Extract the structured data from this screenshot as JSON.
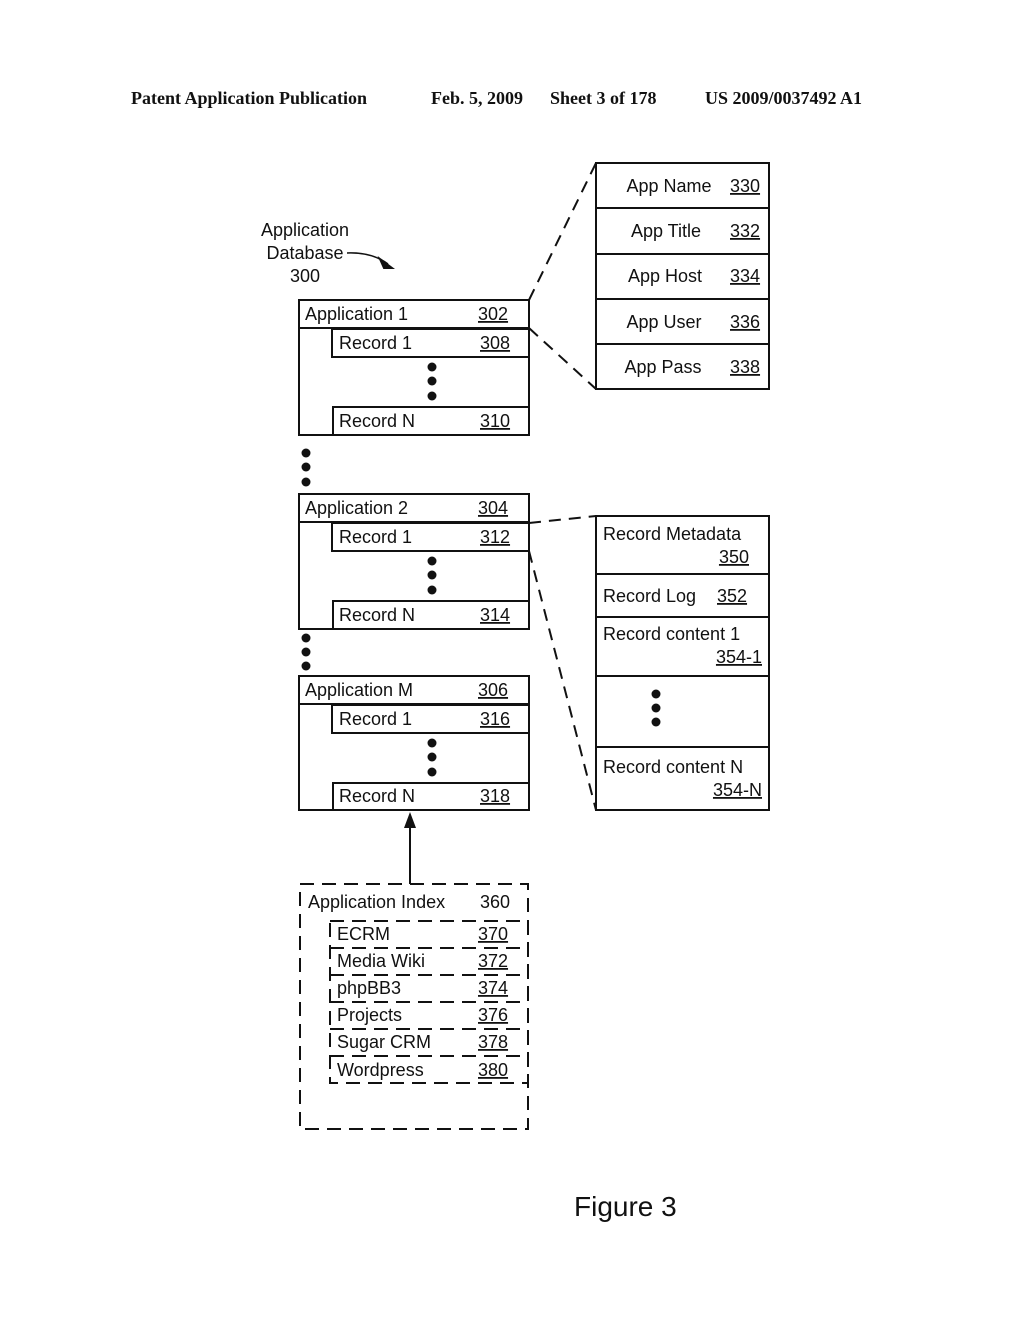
{
  "header": {
    "publication": "Patent Application Publication",
    "date": "Feb. 5, 2009",
    "sheet": "Sheet 3 of 178",
    "number": "US 2009/0037492 A1"
  },
  "database_label": {
    "line1": "Application",
    "line2": "Database",
    "ref": "300"
  },
  "applications": [
    {
      "label": "Application 1",
      "ref": "302",
      "records": [
        {
          "label": "Record 1",
          "ref": "308"
        },
        {
          "label": "Record N",
          "ref": "310"
        }
      ]
    },
    {
      "label": "Application 2",
      "ref": "304",
      "records": [
        {
          "label": "Record 1",
          "ref": "312"
        },
        {
          "label": "Record N",
          "ref": "314"
        }
      ]
    },
    {
      "label": "Application M",
      "ref": "306",
      "records": [
        {
          "label": "Record 1",
          "ref": "316"
        },
        {
          "label": "Record N",
          "ref": "318"
        }
      ]
    }
  ],
  "app_fields": [
    {
      "label": "App Name",
      "ref": "330"
    },
    {
      "label": "App Title",
      "ref": "332"
    },
    {
      "label": "App Host",
      "ref": "334"
    },
    {
      "label": "App User",
      "ref": "336"
    },
    {
      "label": "App Pass",
      "ref": "338"
    }
  ],
  "record_fields": [
    {
      "label": "Record Metadata",
      "ref": "350"
    },
    {
      "label": "Record Log",
      "ref": "352"
    },
    {
      "label": "Record content 1",
      "ref": "354-1"
    },
    {
      "label": "Record content N",
      "ref": "354-N"
    }
  ],
  "index": {
    "label": "Application Index",
    "ref": "360",
    "entries": [
      {
        "label": "ECRM",
        "ref": "370"
      },
      {
        "label": "Media Wiki",
        "ref": "372"
      },
      {
        "label": "phpBB3",
        "ref": "374"
      },
      {
        "label": "Projects",
        "ref": "376"
      },
      {
        "label": "Sugar CRM",
        "ref": "378"
      },
      {
        "label": "Wordpress",
        "ref": "380"
      }
    ]
  },
  "figure_caption": "Figure 3"
}
